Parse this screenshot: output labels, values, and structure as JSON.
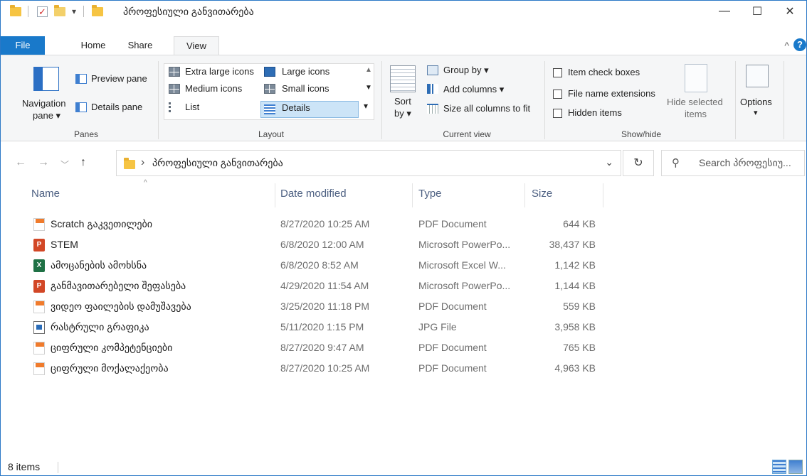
{
  "window": {
    "title": "პროფესიული განვითარება",
    "controls": {
      "minimize": "—",
      "maximize": "☐",
      "close": "✕"
    },
    "qa_dropdown": "▾"
  },
  "tabs": [
    {
      "label": "File"
    },
    {
      "label": "Home"
    },
    {
      "label": "Share"
    },
    {
      "label": "View"
    }
  ],
  "ribbon": {
    "collapse_glyph": "^",
    "help_glyph": "?",
    "panes": {
      "navigation_pane": "Navigation",
      "navigation_pane_2": "pane ▾",
      "preview_pane": "Preview pane",
      "details_pane": "Details pane",
      "label": "Panes"
    },
    "layout": {
      "options": [
        "Extra large icons",
        "Large icons",
        "Medium icons",
        "Small icons",
        "List",
        "Details"
      ],
      "selected": "Details",
      "label": "Layout"
    },
    "current_view": {
      "sort_by": "Sort",
      "sort_by_2": "by ▾",
      "group_by": "Group by ▾",
      "add_columns": "Add columns ▾",
      "size_all_columns": "Size all columns to fit",
      "label": "Current view"
    },
    "show_hide": {
      "item_check_boxes": "Item check boxes",
      "file_name_extensions": "File name extensions",
      "hidden_items": "Hidden items",
      "hide_selected": "Hide selected",
      "hide_selected_2": "items",
      "label": "Show/hide"
    },
    "options": {
      "label": "Options",
      "arrow": "▾"
    }
  },
  "address": {
    "path": "პროფესიული განვითარება",
    "search_placeholder": "Search პროფესიუ..."
  },
  "columns": {
    "name": "Name",
    "date": "Date modified",
    "type": "Type",
    "size": "Size"
  },
  "files": [
    {
      "name": "Scratch გაკვეთილები",
      "date": "8/27/2020 10:25 AM",
      "type": "PDF Document",
      "size": "644 KB",
      "icon": "pdf"
    },
    {
      "name": "STEM",
      "date": "6/8/2020 12:00 AM",
      "type": "Microsoft PowerPo...",
      "size": "38,437 KB",
      "icon": "ppt"
    },
    {
      "name": "ამოცანების ამოხსნა",
      "date": "6/8/2020 8:52 AM",
      "type": "Microsoft Excel W...",
      "size": "1,142 KB",
      "icon": "xls"
    },
    {
      "name": "განმავითარებელი შეფასება",
      "date": "4/29/2020 11:54 AM",
      "type": "Microsoft PowerPo...",
      "size": "1,144 KB",
      "icon": "ppt"
    },
    {
      "name": "ვიდეო ფაილების დამუშავება",
      "date": "3/25/2020 11:18 PM",
      "type": "PDF Document",
      "size": "559 KB",
      "icon": "pdf"
    },
    {
      "name": "რასტრული გრაფიკა",
      "date": "5/11/2020 1:15 PM",
      "type": "JPG File",
      "size": "3,958 KB",
      "icon": "jpg"
    },
    {
      "name": "ციფრული კომპეტენციები",
      "date": "8/27/2020 9:47 AM",
      "type": "PDF Document",
      "size": "765 KB",
      "icon": "pdf"
    },
    {
      "name": "ციფრული მოქალაქეობა",
      "date": "8/27/2020 10:25 AM",
      "type": "PDF Document",
      "size": "4,963 KB",
      "icon": "pdf"
    }
  ],
  "status": {
    "item_count": "8 items"
  },
  "colors": {
    "accent": "#1979ca",
    "selection": "#cce4f7",
    "border": "#2b78c6"
  }
}
